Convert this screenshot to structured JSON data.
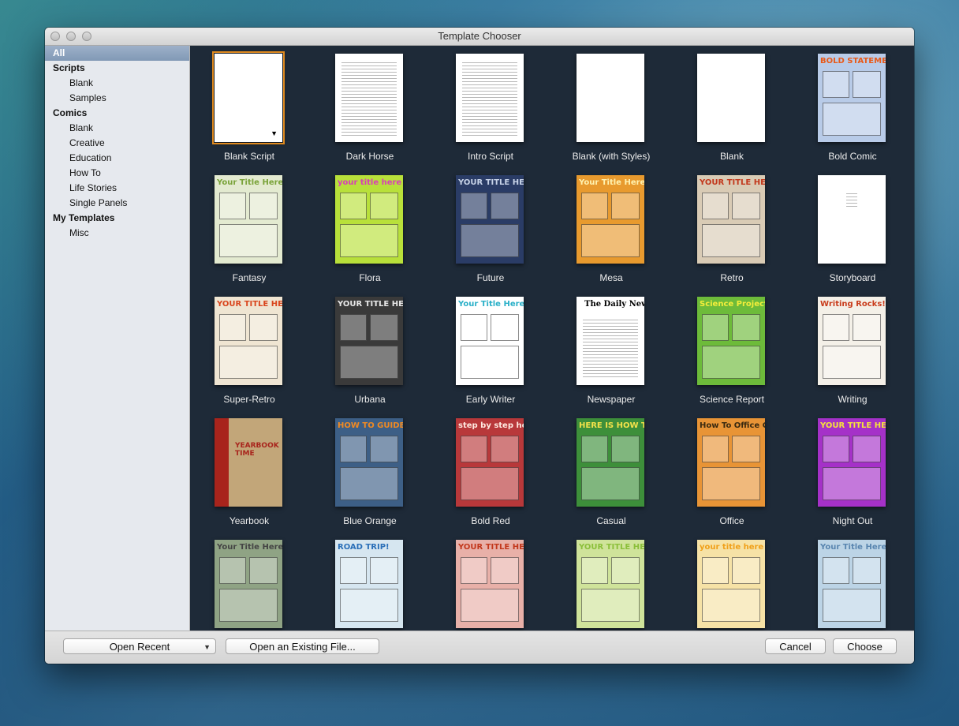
{
  "window": {
    "title": "Template Chooser"
  },
  "sidebar": {
    "items": [
      {
        "label": "All",
        "kind": "selected"
      },
      {
        "label": "Scripts",
        "kind": "header"
      },
      {
        "label": "Blank",
        "kind": "sub"
      },
      {
        "label": "Samples",
        "kind": "sub"
      },
      {
        "label": "Comics",
        "kind": "header"
      },
      {
        "label": "Blank",
        "kind": "sub"
      },
      {
        "label": "Creative",
        "kind": "sub"
      },
      {
        "label": "Education",
        "kind": "sub"
      },
      {
        "label": "How To",
        "kind": "sub"
      },
      {
        "label": "Life Stories",
        "kind": "sub"
      },
      {
        "label": "Single Panels",
        "kind": "sub"
      },
      {
        "label": "My Templates",
        "kind": "header"
      },
      {
        "label": "Misc",
        "kind": "sub"
      }
    ],
    "zoom_level": 0.45
  },
  "templates": [
    {
      "label": "Blank Script",
      "bg": "#ffffff",
      "style": "blank-arrow",
      "selected": true
    },
    {
      "label": "Dark Horse",
      "bg": "#ffffff",
      "style": "text"
    },
    {
      "label": "Intro Script",
      "bg": "#ffffff",
      "style": "text"
    },
    {
      "label": "Blank (with Styles)",
      "bg": "#ffffff",
      "style": "blank"
    },
    {
      "label": "Blank",
      "bg": "#ffffff",
      "style": "blank"
    },
    {
      "label": "Bold Comic",
      "bg": "#b8cbe8",
      "style": "comic",
      "thumb_title": "BOLD STATEMENTS",
      "title_color": "#e85a1a"
    },
    {
      "label": "Fantasy",
      "bg": "#e3ead0",
      "style": "comic",
      "thumb_title": "Your Title Here",
      "title_color": "#7aa33a"
    },
    {
      "label": "Flora",
      "bg": "#b8e03a",
      "style": "comic",
      "thumb_title": "your title here",
      "title_color": "#d83fb8"
    },
    {
      "label": "Future",
      "bg": "#2a3c66",
      "style": "comic",
      "thumb_title": "YOUR TITLE HERE",
      "title_color": "#c7d3e8"
    },
    {
      "label": "Mesa",
      "bg": "#e89a2e",
      "style": "comic",
      "thumb_title": "Your Title Here",
      "title_color": "#fff2b0"
    },
    {
      "label": "Retro",
      "bg": "#d9cbb5",
      "style": "comic",
      "thumb_title": "YOUR TITLE HERE",
      "title_color": "#c2381c"
    },
    {
      "label": "Storyboard",
      "bg": "#ffffff",
      "style": "text-sparse"
    },
    {
      "label": "Super-Retro",
      "bg": "#efe5d2",
      "style": "comic",
      "thumb_title": "YOUR TITLE HERE",
      "title_color": "#d9451d"
    },
    {
      "label": "Urbana",
      "bg": "#3a3a3a",
      "style": "comic",
      "thumb_title": "YOUR TITLE HERE",
      "title_color": "#e8e8e8"
    },
    {
      "label": "Early Writer",
      "bg": "#ffffff",
      "style": "comic",
      "thumb_title": "Your Title Here",
      "title_color": "#2ab0c8"
    },
    {
      "label": "Newspaper",
      "bg": "#ffffff",
      "style": "newspaper",
      "thumb_title": "The Daily News",
      "title_color": "#000000"
    },
    {
      "label": "Science Report",
      "bg": "#6dbb3a",
      "style": "comic",
      "thumb_title": "Science Project",
      "title_color": "#f4ee3a"
    },
    {
      "label": "Writing",
      "bg": "#f4f0e8",
      "style": "comic",
      "thumb_title": "Writing Rocks!",
      "title_color": "#c93c1c"
    },
    {
      "label": "Yearbook",
      "bg": "#c2a679",
      "style": "yearbook",
      "thumb_title": "YEARBOOK TIME",
      "title_color": "#a8241c"
    },
    {
      "label": "Blue Orange",
      "bg": "#3d5f86",
      "style": "comic",
      "thumb_title": "HOW TO GUIDE",
      "title_color": "#f08a22"
    },
    {
      "label": "Bold Red",
      "bg": "#b8383a",
      "style": "comic",
      "thumb_title": "step by step how to...",
      "title_color": "#ffe9e0"
    },
    {
      "label": "Casual",
      "bg": "#3d8f3a",
      "style": "comic",
      "thumb_title": "HERE IS HOW TO...",
      "title_color": "#f4e24a"
    },
    {
      "label": "Office",
      "bg": "#e89436",
      "style": "comic",
      "thumb_title": "How To Office Guide",
      "title_color": "#3a2a10"
    },
    {
      "label": "Night Out",
      "bg": "#a531c8",
      "style": "comic",
      "thumb_title": "YOUR TITLE HERE",
      "title_color": "#f6e43a"
    },
    {
      "label": "",
      "bg": "#8fa384",
      "style": "comic",
      "thumb_title": "Your Title Here",
      "title_color": "#444444"
    },
    {
      "label": "",
      "bg": "#d6e6f0",
      "style": "comic",
      "thumb_title": "ROAD TRIP!",
      "title_color": "#2a6fb8"
    },
    {
      "label": "",
      "bg": "#e8b0a8",
      "style": "comic",
      "thumb_title": "YOUR TITLE HERE",
      "title_color": "#c2381c"
    },
    {
      "label": "",
      "bg": "#cfe39a",
      "style": "comic",
      "thumb_title": "YOUR TITLE HERE",
      "title_color": "#8bbf3a"
    },
    {
      "label": "",
      "bg": "#f6e2a6",
      "style": "comic",
      "thumb_title": "your title here",
      "title_color": "#f0a01a"
    },
    {
      "label": "",
      "bg": "#bcd4e6",
      "style": "comic",
      "thumb_title": "Your Title Here",
      "title_color": "#5a86b0"
    }
  ],
  "footer": {
    "open_recent": "Open Recent",
    "open_existing": "Open an Existing File...",
    "cancel": "Cancel",
    "choose": "Choose"
  }
}
